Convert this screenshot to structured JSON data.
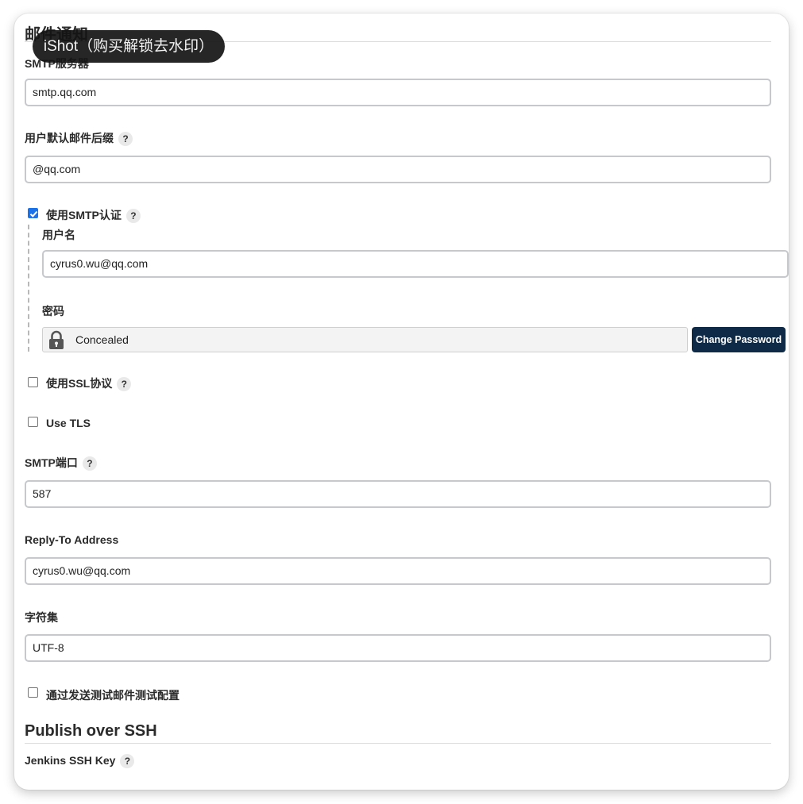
{
  "mail_section": {
    "title": "邮件通知",
    "smtp_server": {
      "label": "SMTP服务器",
      "value": "smtp.qq.com"
    },
    "default_suffix": {
      "label": "用户默认邮件后缀",
      "help": "?",
      "value": "@qq.com"
    },
    "use_smtp_auth": {
      "label": "使用SMTP认证",
      "help": "?",
      "checked": true,
      "username": {
        "label": "用户名",
        "value": "cyrus0.wu@qq.com"
      },
      "password": {
        "label": "密码",
        "concealed_text": "Concealed",
        "change_button": "Change Password"
      }
    },
    "use_ssl": {
      "label": "使用SSL协议",
      "help": "?",
      "checked": false
    },
    "use_tls": {
      "label": "Use TLS",
      "checked": false
    },
    "smtp_port": {
      "label": "SMTP端口",
      "help": "?",
      "value": "587"
    },
    "reply_to": {
      "label": "Reply-To Address",
      "value": "cyrus0.wu@qq.com"
    },
    "charset": {
      "label": "字符集",
      "value": "UTF-8"
    },
    "test_config": {
      "label": "通过发送测试邮件测试配置",
      "checked": false
    }
  },
  "ssh_section": {
    "title": "Publish over SSH",
    "jenkins_ssh_key": {
      "label": "Jenkins SSH Key",
      "help": "?"
    }
  },
  "overlay": {
    "watermark": "iShot（购买解锁去水印）"
  },
  "colors": {
    "accent": "#1a73e8",
    "dark_button": "#0f2a47"
  },
  "icons": {
    "lock": "lock-icon",
    "help": "help-icon",
    "check": "checkmark-icon"
  }
}
